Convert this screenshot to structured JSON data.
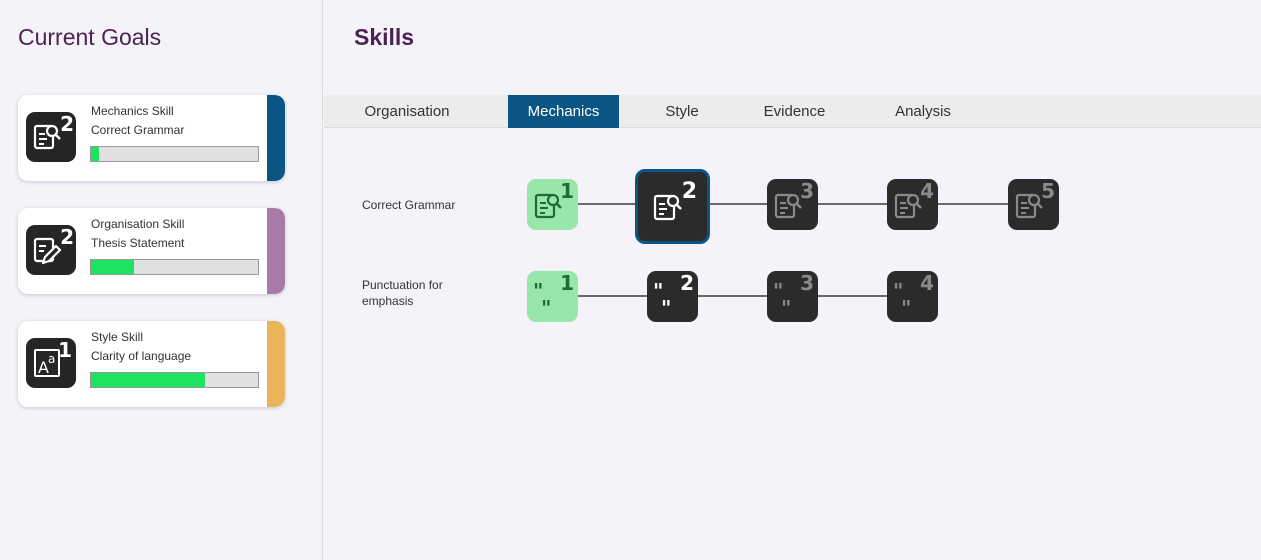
{
  "goals": {
    "title": "Current Goals",
    "items": [
      {
        "skill": "Mechanics Skill",
        "goal": "Correct Grammar",
        "level": "2",
        "progress": 0.05,
        "accent": "#0a5583",
        "icon": "grammar-search-icon"
      },
      {
        "skill": "Organisation Skill",
        "goal": "Thesis Statement",
        "level": "2",
        "progress": 0.26,
        "accent": "#a97aa8",
        "icon": "thesis-edit-icon"
      },
      {
        "skill": "Style Skill",
        "goal": "Clarity of language",
        "level": "1",
        "progress": 0.68,
        "accent": "#e9b45a",
        "icon": "language-clarity-icon"
      }
    ]
  },
  "skills": {
    "title": "Skills",
    "tabs": [
      {
        "label": "Organisation",
        "active": false
      },
      {
        "label": "Mechanics",
        "active": true
      },
      {
        "label": "Style",
        "active": false
      },
      {
        "label": "Evidence",
        "active": false
      },
      {
        "label": "Analysis",
        "active": false
      }
    ],
    "rows": [
      {
        "label": "Correct Grammar",
        "icon": "grammar-search-icon",
        "levels": [
          "1",
          "2",
          "3",
          "4",
          "5"
        ],
        "completed": 1,
        "selected": 2
      },
      {
        "label": "Punctuation for emphasis",
        "icon": "quote-marks-icon",
        "levels": [
          "1",
          "2",
          "3",
          "4"
        ],
        "completed": 1,
        "selected": 0
      }
    ]
  },
  "colors": {
    "accent_blue": "#0a5583",
    "done_green": "#98e6a9",
    "locked_dark": "#2b2b2b",
    "progress_green": "#1de361"
  }
}
